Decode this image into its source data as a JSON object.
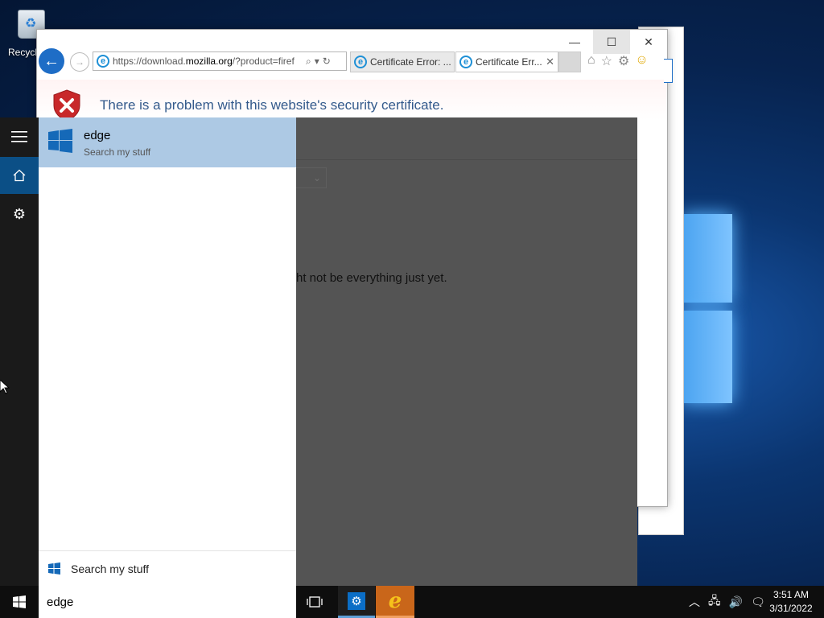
{
  "desktop": {
    "recycle_bin_label": "Recycl"
  },
  "ie": {
    "address_url_prefix": "https://download.",
    "address_url_domain": "mozilla.org",
    "address_url_suffix": "/?product=firef",
    "tabs": [
      {
        "label": "Certificate Error: ..."
      },
      {
        "label": "Certificate Err..."
      }
    ],
    "error_title": "There is a problem with this website's security certificate."
  },
  "overlay": {
    "partial_text": "ht not be everything just yet."
  },
  "search": {
    "result_name": "edge",
    "result_sub": "Search my stuff",
    "search_my_stuff_label": "Search my stuff",
    "query": "edge"
  },
  "taskbar": {
    "time": "3:51 AM",
    "date": "3/31/2022"
  },
  "colors": {
    "search_result_highlight": "#adc9e4",
    "start_rail": "#1a1a1a",
    "home_accent": "#0b4f86",
    "ie_taskbar": "#c9661a"
  }
}
